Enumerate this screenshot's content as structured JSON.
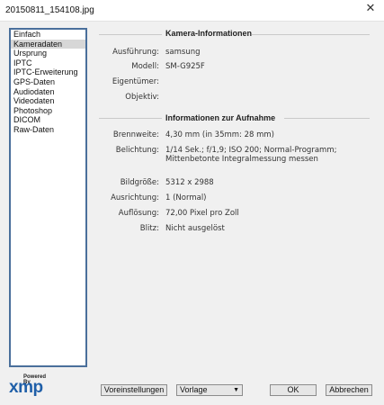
{
  "window": {
    "title": "20150811_154108.jpg",
    "close_glyph": "✕"
  },
  "sidebar": {
    "items": [
      {
        "label": "Einfach"
      },
      {
        "label": "Kameradaten"
      },
      {
        "label": "Ursprung"
      },
      {
        "label": "IPTC"
      },
      {
        "label": "IPTC-Erweiterung"
      },
      {
        "label": "GPS-Daten"
      },
      {
        "label": "Audiodaten"
      },
      {
        "label": "Videodaten"
      },
      {
        "label": "Photoshop"
      },
      {
        "label": "DICOM"
      },
      {
        "label": "Raw-Daten"
      }
    ],
    "selected": "Kameradaten"
  },
  "camera_info": {
    "title": "Kamera-Informationen",
    "rows": [
      {
        "label": "Ausführung:",
        "value": "samsung"
      },
      {
        "label": "Modell:",
        "value": "SM-G925F"
      },
      {
        "label": "Eigentümer:",
        "value": ""
      },
      {
        "label": "Objektiv:",
        "value": ""
      }
    ]
  },
  "capture_info": {
    "title": "Informationen zur Aufnahme",
    "brennweite_label": "Brennweite:",
    "brennweite_value": "4,30 mm   (in 35mm: 28 mm)",
    "belichtung_label": "Belichtung:",
    "belichtung_line1": "1/14 Sek.;   f/1,9;   ISO 200;   Normal-Programm;",
    "belichtung_line2": "Mittenbetonte Integralmessung messen",
    "rows": [
      {
        "label": "Bildgröße:",
        "value": "5312 x 2988"
      },
      {
        "label": "Ausrichtung:",
        "value": "1 (Normal)"
      },
      {
        "label": "Auflösung:",
        "value": "72,00 Pixel pro Zoll"
      },
      {
        "label": "Blitz:",
        "value": "Nicht ausgelöst"
      }
    ]
  },
  "logo": {
    "powered_by": "Powered By",
    "xmp": "xmp"
  },
  "buttons": {
    "preferences": "Voreinstellungen",
    "template": "Vorlage",
    "ok": "OK",
    "cancel": "Abbrechen"
  },
  "icons": {
    "dropdown_arrow": "▼"
  }
}
